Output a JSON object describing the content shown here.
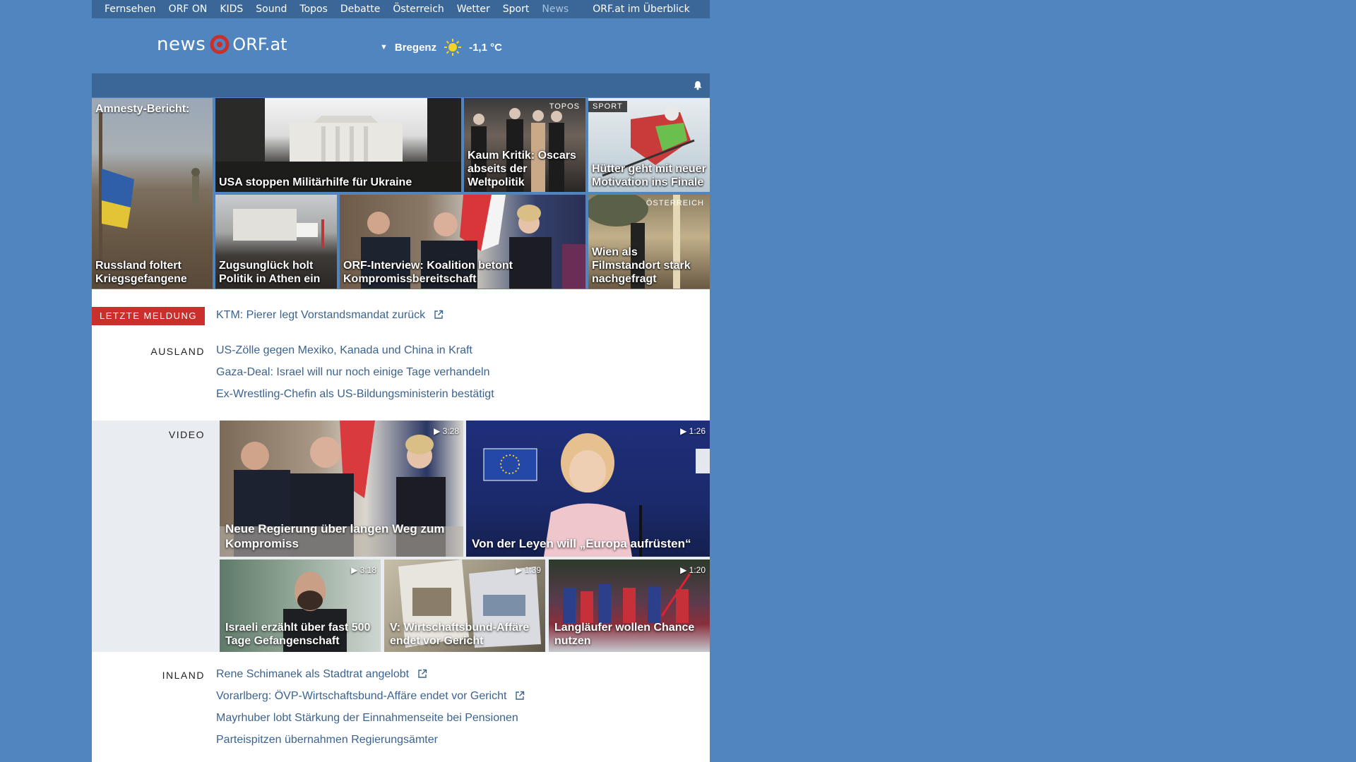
{
  "nav": {
    "items": [
      "Fernsehen",
      "ORF ON",
      "KIDS",
      "Sound",
      "Topos",
      "Debatte",
      "Österreich",
      "Wetter",
      "Sport",
      "News"
    ],
    "overview": "ORF.at im Überblick"
  },
  "header": {
    "logo_news": "news",
    "logo_orf": "ORF.at",
    "weather_city": "Bregenz",
    "weather_temp": "-1,1 °C"
  },
  "teasers": [
    {
      "top": "Amnesty-Bericht:",
      "caption": "Russland foltert Kriegsgefangene",
      "tag": ""
    },
    {
      "caption": "USA stoppen Militärhilfe für Ukraine",
      "tag": ""
    },
    {
      "caption": "Kaum Kritik: Oscars abseits der Weltpolitik",
      "tag": "TOPOS"
    },
    {
      "caption": "Hütter geht mit neuer Motivation ins Finale",
      "tag": "SPORT"
    },
    {
      "caption": "Zugsunglück holt Politik in Athen ein",
      "tag": ""
    },
    {
      "caption": "ORF-Interview: Koalition betont Kompromissbereitschaft",
      "tag": ""
    },
    {
      "caption": "Wien als Filmstandort stark nachgefragt",
      "tag": "ÖSTERREICH"
    }
  ],
  "breaking": {
    "label": "LETZTE MELDUNG",
    "text": "KTM: Pierer legt Vorstandsmandat zurück"
  },
  "ausland": {
    "label": "AUSLAND",
    "links": [
      "US-Zölle gegen Mexiko, Kanada und China in Kraft",
      "Gaza-Deal: Israel will nur noch einige Tage verhandeln",
      "Ex-Wrestling-Chefin als US-Bildungsministerin bestätigt"
    ]
  },
  "video": {
    "label": "VIDEO",
    "items": [
      {
        "caption": "Neue Regierung über langen Weg zum Kompromiss",
        "duration": "3:28"
      },
      {
        "caption": "Von der Leyen will „Europa aufrüsten“",
        "duration": "1:26"
      },
      {
        "caption": "Israeli erzählt über fast 500 Tage Gefangenschaft",
        "duration": "3:18"
      },
      {
        "caption": "V: Wirtschaftsbund-Affäre endet vor Gericht",
        "duration": "1:39"
      },
      {
        "caption": "Langläufer wollen Chance nutzen",
        "duration": "1:20"
      }
    ]
  },
  "inland": {
    "label": "INLAND",
    "links": [
      "Rene Schimanek als Stadtrat angelobt",
      "Vorarlberg: ÖVP-Wirtschaftsbund-Affäre endet vor Gericht",
      "Mayrhuber lobt Stärkung der Einnahmenseite bei Pensionen",
      "Parteispitzen übernahmen Regierungsämter"
    ]
  },
  "colors": {
    "background": "#5185c0",
    "nav": "#3b6798",
    "link": "#3b6390",
    "breaking": "#c9302c"
  }
}
